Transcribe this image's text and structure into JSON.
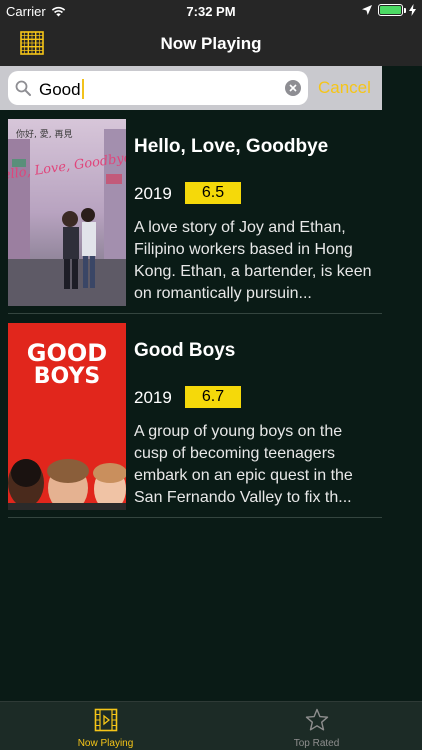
{
  "status_bar": {
    "carrier": "Carrier",
    "time": "7:32 PM",
    "battery_level": 1.0
  },
  "nav": {
    "title": "Now Playing",
    "left_icon": "grid-icon"
  },
  "search": {
    "value": "Good",
    "cancel_label": "Cancel"
  },
  "movies": [
    {
      "title": "Hello, Love, Goodbye",
      "year": "2019",
      "rating": "6.5",
      "overview": "A love story of Joy and Ethan, Filipino workers based in Hong Kong. Ethan, a bartender, is keen on romantically pursuin...",
      "poster_text": "Hello, Love, Goodbye",
      "poster_tagline": "你好, 愛, 再見"
    },
    {
      "title": "Good Boys",
      "year": "2019",
      "rating": "6.7",
      "overview": "A group of young boys on the cusp of becoming teenagers embark on an epic quest in the San Fernando Valley to fix th...",
      "poster_text_1": "GOOD",
      "poster_text_2": "BOYS"
    }
  ],
  "tabs": [
    {
      "label": "Now Playing",
      "icon": "film-icon",
      "selected": true
    },
    {
      "label": "Top Rated",
      "icon": "star-icon",
      "selected": false
    }
  ],
  "colors": {
    "accent": "#f5c518",
    "background": "#0a1b16",
    "bar": "#262626",
    "rating_badge": "#f5d90a"
  }
}
